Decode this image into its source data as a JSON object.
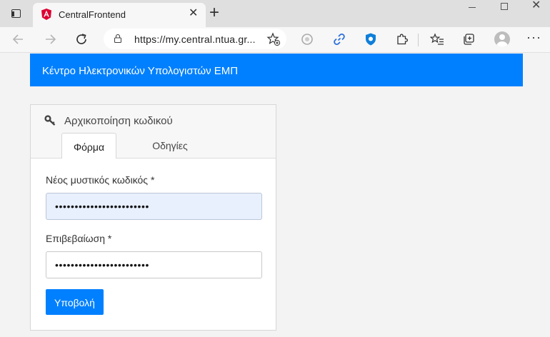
{
  "browser": {
    "tab_title": "CentralFrontend",
    "url": "https://my.central.ntua.gr...",
    "new_tab_glyph": "+",
    "close_glyph": "✕",
    "more_glyph": "···"
  },
  "header": {
    "title": "Κέντρο Ηλεκτρονικών Υπολογιστών ΕΜΠ"
  },
  "card": {
    "title": "Αρχικοποίηση κωδικού",
    "tabs": [
      {
        "label": "Φόρμα",
        "active": true
      },
      {
        "label": "Οδηγίες",
        "active": false
      }
    ]
  },
  "form": {
    "new_password_label": "Νέος μυστικός κωδικός *",
    "new_password_value": "••••••••••••••••••••••••",
    "confirm_label": "Επιβεβαίωση *",
    "confirm_value": "••••••••••••••••••••••••",
    "submit_label": "Υποβολή"
  },
  "colors": {
    "brand": "#0080ff",
    "autofill": "#e8f0fe"
  }
}
